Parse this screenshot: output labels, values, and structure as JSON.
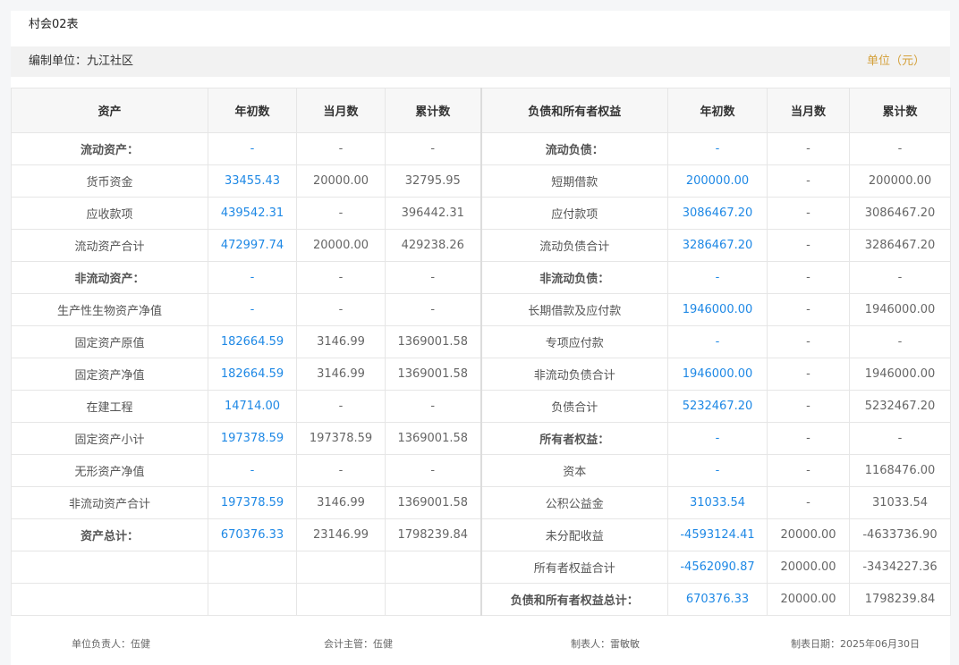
{
  "report_title": "村会02表",
  "org_label": "编制单位：",
  "org_name": "九江社区",
  "unit": "单位（元）",
  "headers": [
    "资产",
    "年初数",
    "当月数",
    "累计数",
    "负债和所有者权益",
    "年初数",
    "当月数",
    "累计数"
  ],
  "rows": [
    [
      "流动资产：",
      "-",
      "-",
      "-",
      "流动负债：",
      "-",
      "-",
      "-"
    ],
    [
      "货币资金",
      "33455.43",
      "20000.00",
      "32795.95",
      "短期借款",
      "200000.00",
      "-",
      "200000.00"
    ],
    [
      "应收款项",
      "439542.31",
      "-",
      "396442.31",
      "应付款项",
      "3086467.20",
      "-",
      "3086467.20"
    ],
    [
      "流动资产合计",
      "472997.74",
      "20000.00",
      "429238.26",
      "流动负债合计",
      "3286467.20",
      "-",
      "3286467.20"
    ],
    [
      "非流动资产：",
      "-",
      "-",
      "-",
      "非流动负债：",
      "-",
      "-",
      "-"
    ],
    [
      "生产性生物资产净值",
      "-",
      "-",
      "-",
      "长期借款及应付款",
      "1946000.00",
      "-",
      "1946000.00"
    ],
    [
      "固定资产原值",
      "182664.59",
      "3146.99",
      "1369001.58",
      "专项应付款",
      "-",
      "-",
      "-"
    ],
    [
      "固定资产净值",
      "182664.59",
      "3146.99",
      "1369001.58",
      "非流动负债合计",
      "1946000.00",
      "-",
      "1946000.00"
    ],
    [
      "在建工程",
      "14714.00",
      "-",
      "-",
      "负债合计",
      "5232467.20",
      "-",
      "5232467.20"
    ],
    [
      "固定资产小计",
      "197378.59",
      "197378.59",
      "1369001.58",
      "所有者权益：",
      "-",
      "-",
      "-"
    ],
    [
      "无形资产净值",
      "-",
      "-",
      "-",
      "资本",
      "-",
      "-",
      "1168476.00"
    ],
    [
      "非流动资产合计",
      "197378.59",
      "3146.99",
      "1369001.58",
      "公积公益金",
      "31033.54",
      "-",
      "31033.54"
    ],
    [
      "资产总计：",
      "670376.33",
      "23146.99",
      "1798239.84",
      "未分配收益",
      "-4593124.41",
      "20000.00",
      "-4633736.90"
    ],
    [
      "",
      "",
      "",
      "",
      "所有者权益合计",
      "-4562090.87",
      "20000.00",
      "-3434227.36"
    ],
    [
      "",
      "",
      "",
      "",
      "负债和所有者权益总计：",
      "670376.33",
      "20000.00",
      "1798239.84"
    ]
  ],
  "bold_left": [
    0,
    4,
    12
  ],
  "bold_right": [
    0,
    4,
    9,
    14
  ],
  "footer": {
    "unit_head": "单位负责人：伍健",
    "accountant": "会计主管：伍健",
    "preparer": "制表人：雷敏敏",
    "date": "制表日期：2025年06月30日"
  },
  "colors": {
    "accent_blue": "#1e88e5",
    "unit_gold": "#d4a03a"
  }
}
